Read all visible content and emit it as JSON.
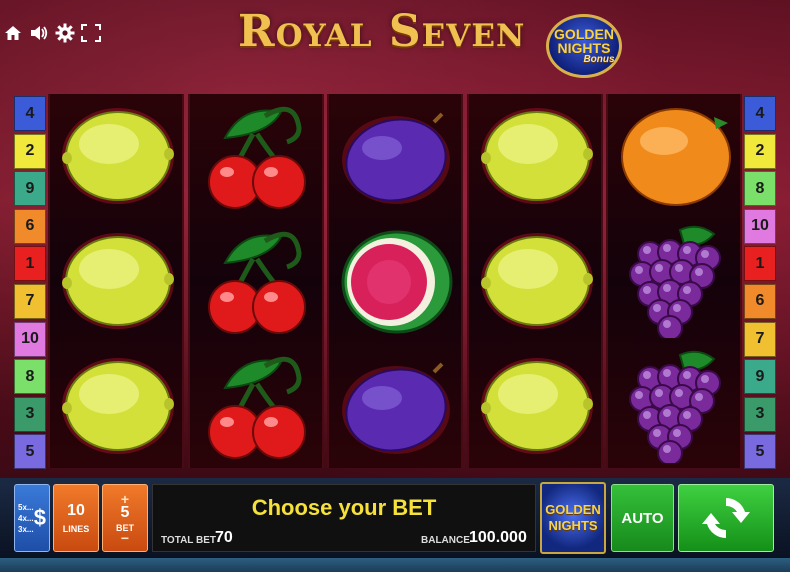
{
  "game": {
    "title": "Royal Seven",
    "badge": {
      "line1": "GOLDEN",
      "line2": "NIGHTS",
      "line3": "Bonus"
    }
  },
  "top_icons": [
    "home-icon",
    "sound-icon",
    "gear-icon",
    "fullscreen-icon"
  ],
  "lines_left": [
    {
      "n": "4",
      "color": "#3b5bd8"
    },
    {
      "n": "2",
      "color": "#f0e83a"
    },
    {
      "n": "9",
      "color": "#3aaa8a"
    },
    {
      "n": "6",
      "color": "#f08a2a"
    },
    {
      "n": "1",
      "color": "#e82020"
    },
    {
      "n": "7",
      "color": "#f0c030"
    },
    {
      "n": "10",
      "color": "#e07ae0"
    },
    {
      "n": "8",
      "color": "#7ae06a"
    },
    {
      "n": "3",
      "color": "#3a9a6a"
    },
    {
      "n": "5",
      "color": "#7a6ae0"
    }
  ],
  "lines_right": [
    {
      "n": "4",
      "color": "#3b5bd8"
    },
    {
      "n": "2",
      "color": "#f0e83a"
    },
    {
      "n": "8",
      "color": "#7ae06a"
    },
    {
      "n": "10",
      "color": "#e07ae0"
    },
    {
      "n": "1",
      "color": "#e82020"
    },
    {
      "n": "6",
      "color": "#f08a2a"
    },
    {
      "n": "7",
      "color": "#f0c030"
    },
    {
      "n": "9",
      "color": "#3aaa8a"
    },
    {
      "n": "3",
      "color": "#3a9a6a"
    },
    {
      "n": "5",
      "color": "#7a6ae0"
    }
  ],
  "reels": [
    [
      "lemon",
      "lemon",
      "lemon"
    ],
    [
      "cherry",
      "cherry",
      "cherry"
    ],
    [
      "plum",
      "watermelon",
      "plum"
    ],
    [
      "lemon",
      "lemon",
      "lemon"
    ],
    [
      "orange",
      "grapes",
      "grapes"
    ]
  ],
  "panel": {
    "paytable": {
      "rows": [
        "5x...",
        "4x...",
        "3x..."
      ],
      "symbol": "$"
    },
    "lines": {
      "value": "10",
      "label": "LINES"
    },
    "bet": {
      "value": "5",
      "label": "BET",
      "plus": "+",
      "minus": "−"
    },
    "message": "Choose your BET",
    "total_bet_label": "TOTAL BET",
    "total_bet_value": "70",
    "balance_label": "BALANCE",
    "balance_value": "100.000",
    "golden_nights": {
      "line1": "GOLDEN",
      "line2": "NIGHTS"
    },
    "auto_label": "AUTO"
  }
}
